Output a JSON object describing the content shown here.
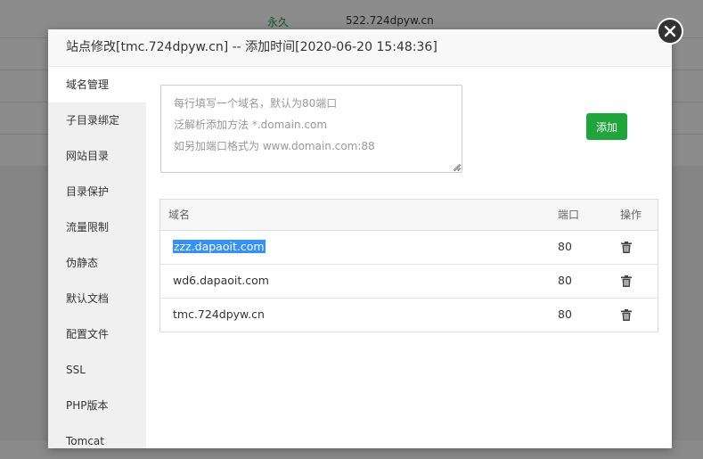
{
  "background": {
    "row": {
      "term": "永久",
      "domain": "522.724dpyw.cn"
    }
  },
  "modal": {
    "title": "站点修改[tmc.724dpyw.cn] -- 添加时间[2020-06-20 15:48:36]",
    "close_icon": "close-icon"
  },
  "sidebar": {
    "items": [
      {
        "label": "域名管理",
        "active": true
      },
      {
        "label": "子目录绑定"
      },
      {
        "label": "网站目录"
      },
      {
        "label": "目录保护"
      },
      {
        "label": "流量限制"
      },
      {
        "label": "伪静态"
      },
      {
        "label": "默认文档"
      },
      {
        "label": "配置文件"
      },
      {
        "label": "SSL"
      },
      {
        "label": "PHP版本"
      },
      {
        "label": "Tomcat"
      }
    ]
  },
  "domain_form": {
    "placeholder_lines": [
      "每行填写一个域名，默认为80端口",
      "泛解析添加方法 *.domain.com",
      "如另加端口格式为 www.domain.com:88"
    ],
    "add_label": "添加"
  },
  "domain_table": {
    "headers": {
      "domain": "域名",
      "port": "端口",
      "action": "操作"
    },
    "rows": [
      {
        "domain": "zzz.dapaoit.com",
        "port": "80",
        "selected": true
      },
      {
        "domain": "wd6.dapaoit.com",
        "port": "80"
      },
      {
        "domain": "tmc.724dpyw.cn",
        "port": "80"
      }
    ]
  },
  "colors": {
    "accent": "#20a53a",
    "selection": "#3390ff"
  }
}
